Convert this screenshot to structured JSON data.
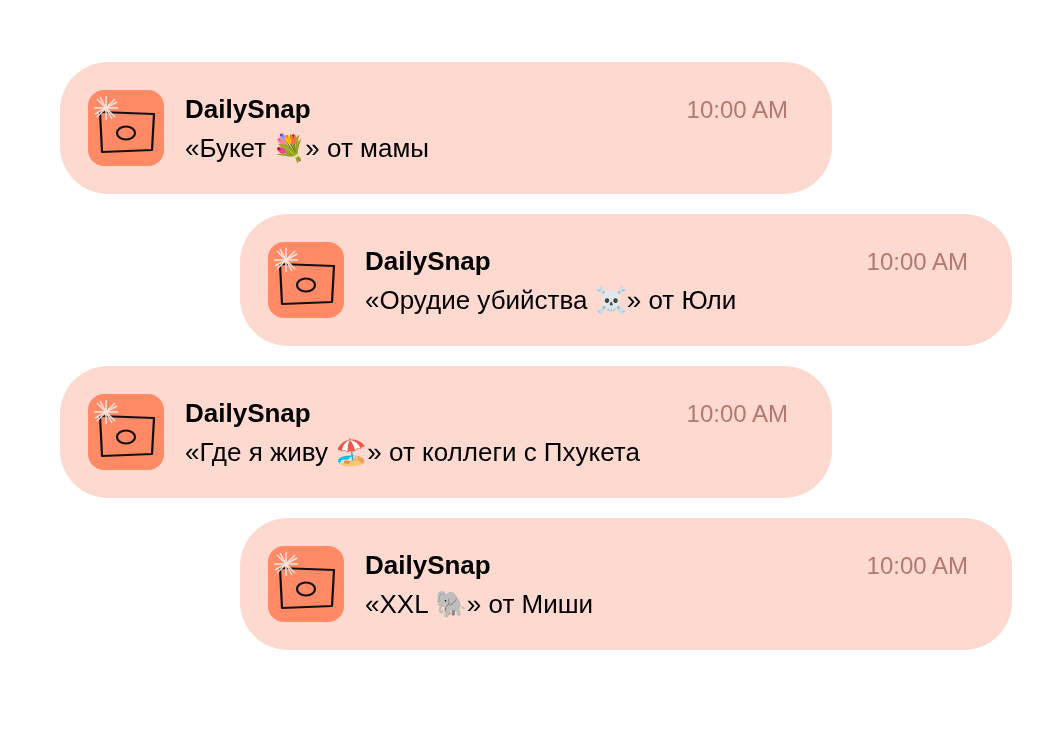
{
  "notifications": [
    {
      "app": "DailySnap",
      "time": "10:00 AM",
      "message": "«Букет 💐» от мамы"
    },
    {
      "app": "DailySnap",
      "time": "10:00 AM",
      "message": "«Орудие убийства ☠️» от Юли"
    },
    {
      "app": "DailySnap",
      "time": "10:00 AM",
      "message": "«Где я живу 🏖️» от коллеги с Пхукета"
    },
    {
      "app": "DailySnap",
      "time": "10:00 AM",
      "message": "«XXL 🐘» от Миши"
    }
  ]
}
